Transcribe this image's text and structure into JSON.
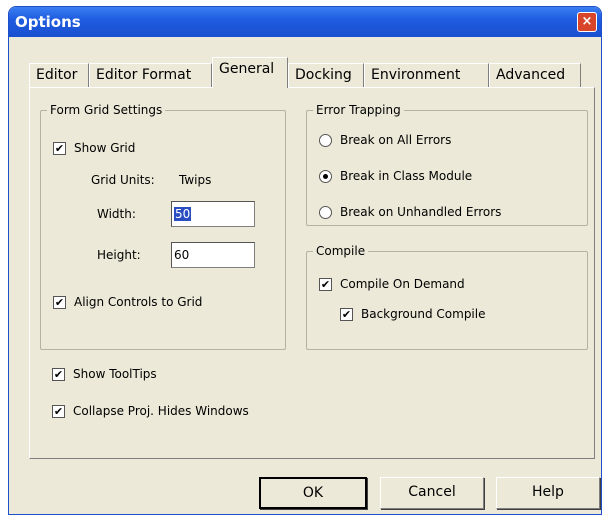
{
  "window": {
    "title": "Options",
    "close_symbol": "×"
  },
  "tabs": [
    {
      "label": "Editor"
    },
    {
      "label": "Editor Format"
    },
    {
      "label": "General",
      "active": true
    },
    {
      "label": "Docking"
    },
    {
      "label": "Environment"
    },
    {
      "label": "Advanced"
    }
  ],
  "form_grid": {
    "title": "Form Grid Settings",
    "show_grid": {
      "label": "Show Grid",
      "checked": true
    },
    "grid_units_label": "Grid Units:",
    "grid_units_value": "Twips",
    "width_label": "Width:",
    "width_value": "50",
    "height_label": "Height:",
    "height_value": "60",
    "align_controls": {
      "label": "Align Controls to Grid",
      "checked": true
    }
  },
  "misc": {
    "show_tooltips": {
      "label": "Show ToolTips",
      "checked": true
    },
    "collapse_proj": {
      "label": "Collapse Proj. Hides Windows",
      "checked": true
    }
  },
  "error_trapping": {
    "title": "Error Trapping",
    "options": [
      {
        "label": "Break on All Errors",
        "selected": false
      },
      {
        "label": "Break in Class Module",
        "selected": true
      },
      {
        "label": "Break on Unhandled Errors",
        "selected": false
      }
    ]
  },
  "compile": {
    "title": "Compile",
    "compile_on_demand": {
      "label": "Compile On Demand",
      "checked": true
    },
    "background_compile": {
      "label": "Background Compile",
      "checked": true
    }
  },
  "buttons": {
    "ok": "OK",
    "cancel": "Cancel",
    "help": "Help"
  },
  "check_glyph": "✔"
}
